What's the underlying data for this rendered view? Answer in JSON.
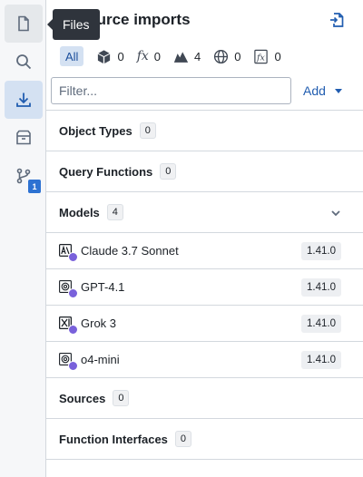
{
  "tooltip": "Files",
  "rail": {
    "items": [
      {
        "icon": "file-icon"
      },
      {
        "icon": "search-icon"
      },
      {
        "icon": "import-icon"
      },
      {
        "icon": "archive-icon"
      },
      {
        "icon": "git-branch-icon",
        "badge": "1"
      }
    ]
  },
  "panel": {
    "title": "Resource imports",
    "filters": {
      "all_label": "All",
      "object_count": "0",
      "function_count": "0",
      "model_count": "4",
      "source_count": "0",
      "interface_count": "0",
      "fx_glyph": "fx"
    },
    "search": {
      "placeholder": "Filter...",
      "value": ""
    },
    "add_label": "Add",
    "sections": {
      "object_types": {
        "label": "Object Types",
        "count": "0"
      },
      "query_functions": {
        "label": "Query Functions",
        "count": "0"
      },
      "models": {
        "label": "Models",
        "count": "4"
      },
      "sources": {
        "label": "Sources",
        "count": "0"
      },
      "function_interfaces": {
        "label": "Function Interfaces",
        "count": "0"
      }
    },
    "models": [
      {
        "name": "Claude 3.7 Sonnet",
        "version": "1.41.0",
        "icon": "anthropic-icon"
      },
      {
        "name": "GPT-4.1",
        "version": "1.41.0",
        "icon": "openai-icon"
      },
      {
        "name": "Grok 3",
        "version": "1.41.0",
        "icon": "xai-icon"
      },
      {
        "name": "o4-mini",
        "version": "1.41.0",
        "icon": "openai-icon"
      }
    ]
  },
  "colors": {
    "accent": "#215db0",
    "badge": "#2d72d2",
    "model_check": "#7961db",
    "active_bg": "#d4e1f2"
  }
}
